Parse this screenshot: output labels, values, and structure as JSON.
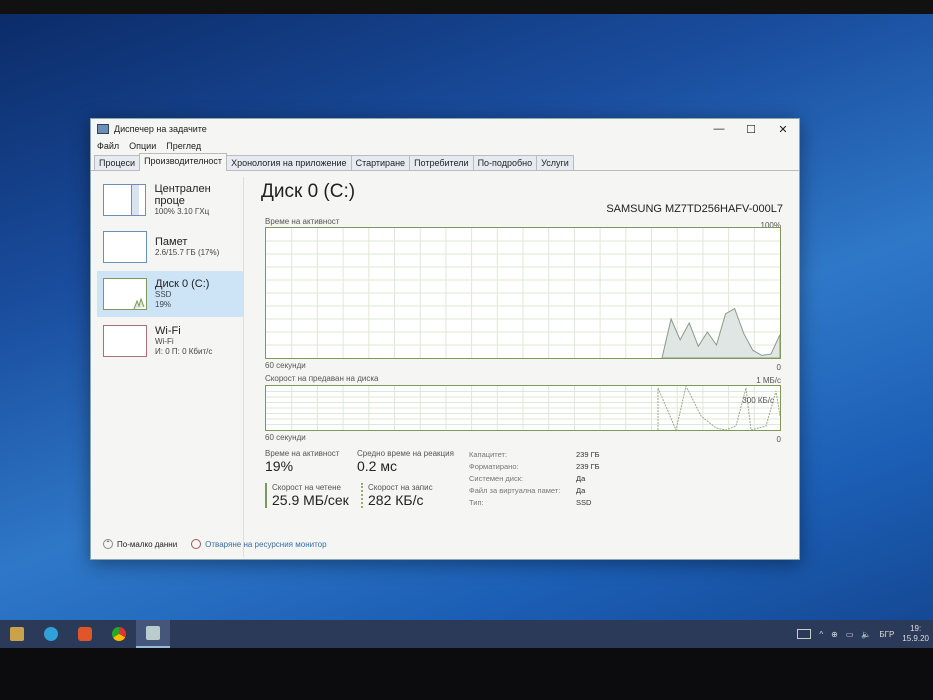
{
  "window": {
    "title": "Диспечер на задачите",
    "minimize": "—",
    "maximize": "☐",
    "close": "✕"
  },
  "menu": [
    "Файл",
    "Опции",
    "Преглед"
  ],
  "tabs": [
    "Процеси",
    "Производителност",
    "Хронология на приложение",
    "Стартиране",
    "Потребители",
    "По-подробно",
    "Услуги"
  ],
  "sidebar": [
    {
      "title": "Централен проце",
      "sub1": "100% 3.10 ГХц",
      "sub2": ""
    },
    {
      "title": "Памет",
      "sub1": "2.6/15.7 ГБ (17%)",
      "sub2": ""
    },
    {
      "title": "Диск 0 (C:)",
      "sub1": "SSD",
      "sub2": "19%"
    },
    {
      "title": "Wi-Fi",
      "sub1": "Wi-Fi",
      "sub2": "И: 0 П: 0 Кбит/с"
    }
  ],
  "main": {
    "title": "Диск 0 (C:)",
    "model": "SAMSUNG MZ7TD256HAFV-000L7",
    "graph1": {
      "label": "Време на активност",
      "max": "100%",
      "min": "0",
      "time": "60 секунди",
      "values_pct": [
        0,
        30,
        14,
        27,
        9,
        20,
        10,
        34,
        38,
        19,
        6,
        2,
        3,
        18
      ]
    },
    "graph2": {
      "label": "Скорост на предаван на диска",
      "max": "1 МБ/с",
      "mid": "300 КБ/с",
      "min": "0",
      "time": "60 секунди"
    },
    "stats": {
      "active_label": "Време на активност",
      "active": "19%",
      "resp_label": "Средно време на реакция",
      "resp": "0.2 мс",
      "read_label": "Скорост на четене",
      "read": "25.9 МБ/сек",
      "write_label": "Скорост на запис",
      "write": "282 КБ/с"
    },
    "props": [
      {
        "k": "Капацитет:",
        "v": "239 ГБ"
      },
      {
        "k": "Форматирано:",
        "v": "239 ГБ"
      },
      {
        "k": "Системен диск:",
        "v": "Да"
      },
      {
        "k": "Файл за виртуална памет:",
        "v": "Да"
      },
      {
        "k": "Тип:",
        "v": "SSD"
      }
    ]
  },
  "footer": {
    "less": "По-малко данни",
    "monitor": "Отваряне на ресурсния монитор"
  },
  "taskbar": {
    "lang": "БГР",
    "time": "19:",
    "date": "15.9.20"
  },
  "colors": {
    "disk": "#7a9a5a",
    "selected": "#cce4f5"
  }
}
